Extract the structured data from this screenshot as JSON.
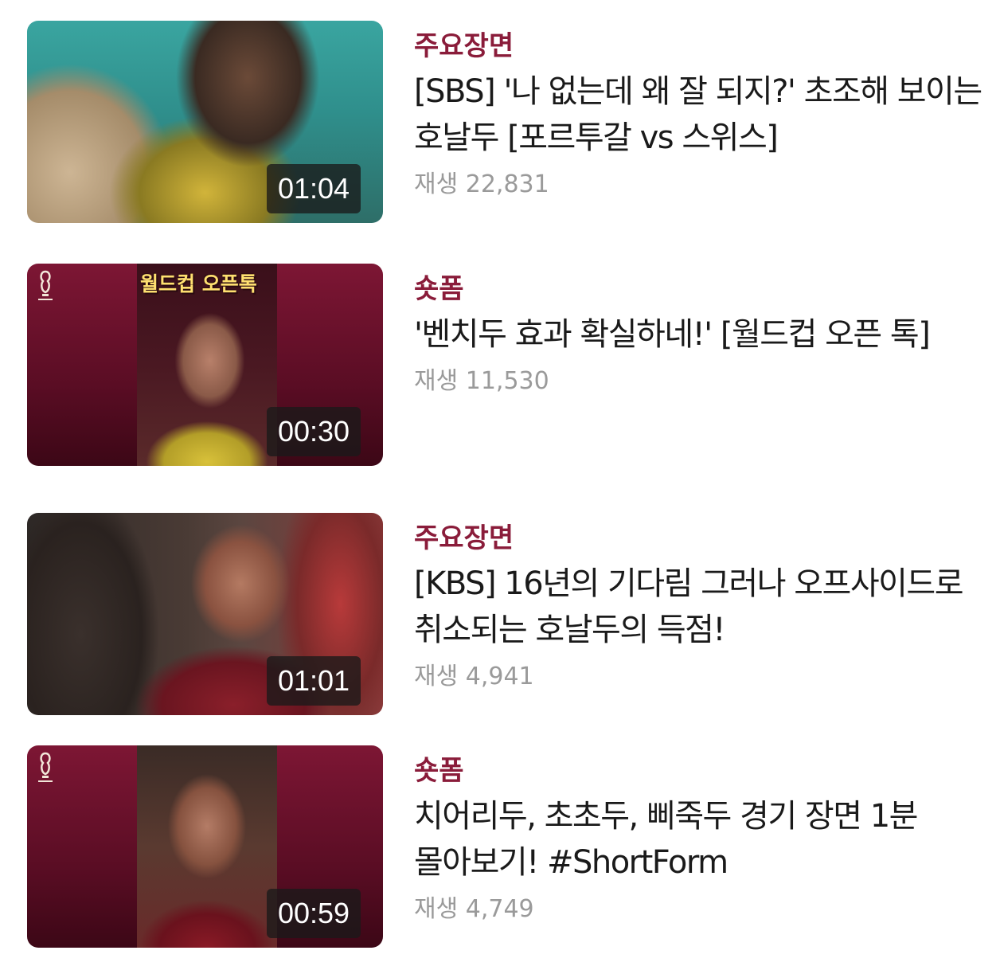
{
  "videos": [
    {
      "category": "주요장면",
      "title": "[SBS] '나 없는데 왜 잘 되지?' 초조해 보이는 호날두 [포르투갈 vs 스위스]",
      "views": "재생 22,831",
      "duration": "01:04"
    },
    {
      "category": "숏폼",
      "title": "'벤치두 효과 확실하네!' [월드컵 오픈 톡]",
      "views": "재생 11,530",
      "duration": "00:30",
      "thumb_text": "월드컵 오픈톡"
    },
    {
      "category": "주요장면",
      "title": "[KBS] 16년의 기다림 그러나 오프사이드로 취소되는 호날두의 득점!",
      "views": "재생 4,941",
      "duration": "01:01"
    },
    {
      "category": "숏폼",
      "title": "치어리두, 초초두, 삐죽두 경기 장면 1분 몰아보기! #ShortForm",
      "views": "재생 4,749",
      "duration": "00:59"
    }
  ],
  "colors": {
    "category": "#8a1c3a",
    "title": "#1a1a1a",
    "views": "#9a9a9a",
    "duration_bg": "#191919"
  }
}
